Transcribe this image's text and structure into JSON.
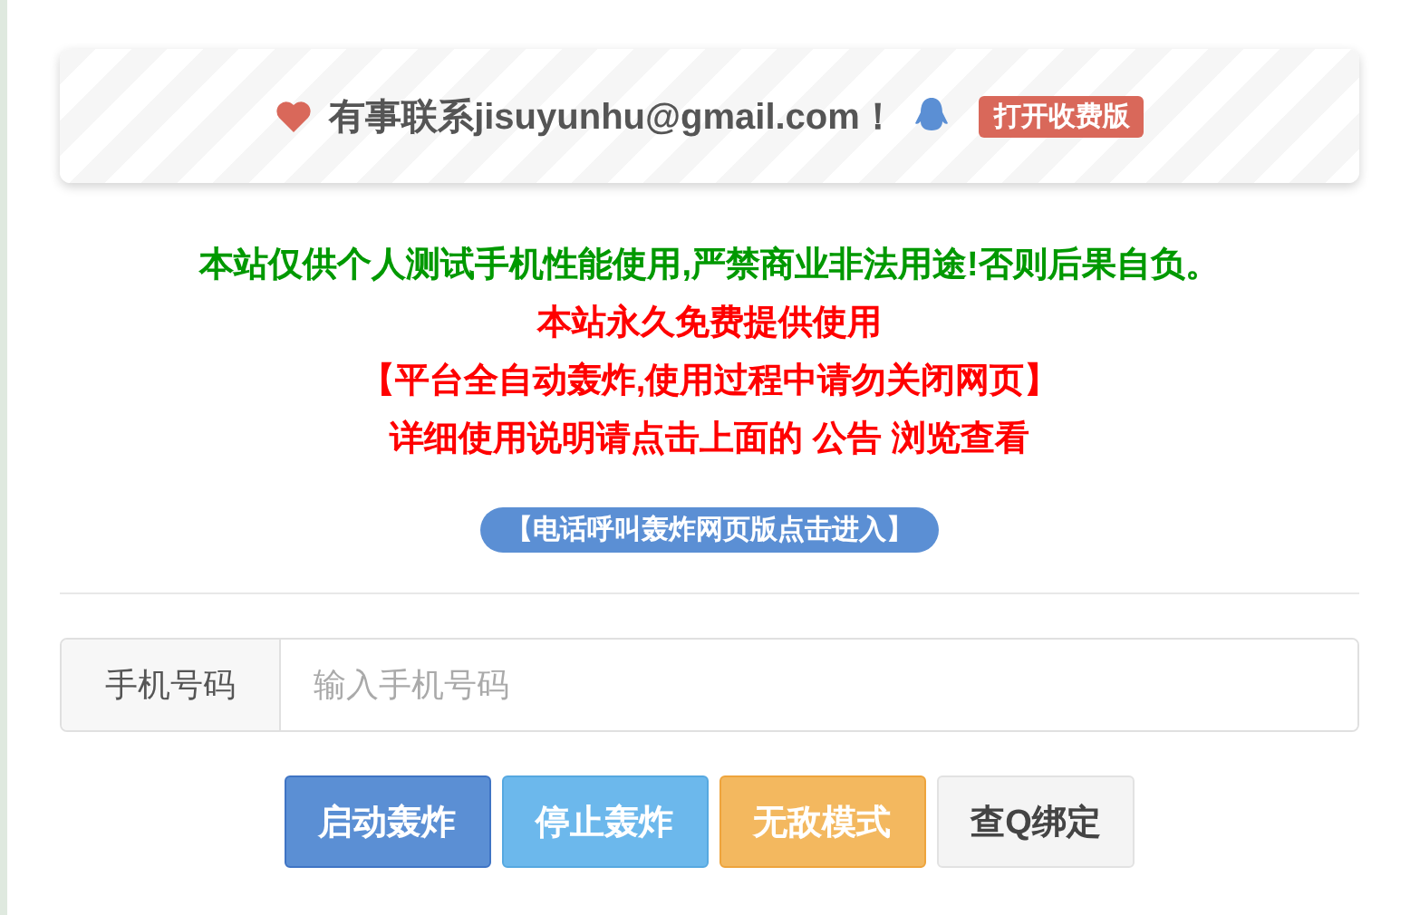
{
  "contact": {
    "text": "有事联系jisuyunhu@gmail.com！",
    "badge": "打开收费版"
  },
  "notices": [
    {
      "text": "本站仅供个人测试手机性能使用,严禁商业非法用途!否则后果自负。",
      "color": "#009900"
    },
    {
      "text": "本站永久免费提供使用",
      "color": "#ff0000"
    },
    {
      "text": "【平台全自动轰炸,使用过程中请勿关闭网页】",
      "color": "#ff0000"
    },
    {
      "text": "详细使用说明请点击上面的 公告 浏览查看",
      "color": "#ff0000"
    }
  ],
  "link": "【电话呼叫轰炸网页版点击进入】",
  "phone": {
    "label": "手机号码",
    "placeholder": "输入手机号码"
  },
  "buttons": [
    {
      "label": "启动轰炸",
      "kind": "primary"
    },
    {
      "label": "停止轰炸",
      "kind": "info"
    },
    {
      "label": "无敌模式",
      "kind": "warning"
    },
    {
      "label": "查Q绑定",
      "kind": "default"
    }
  ]
}
